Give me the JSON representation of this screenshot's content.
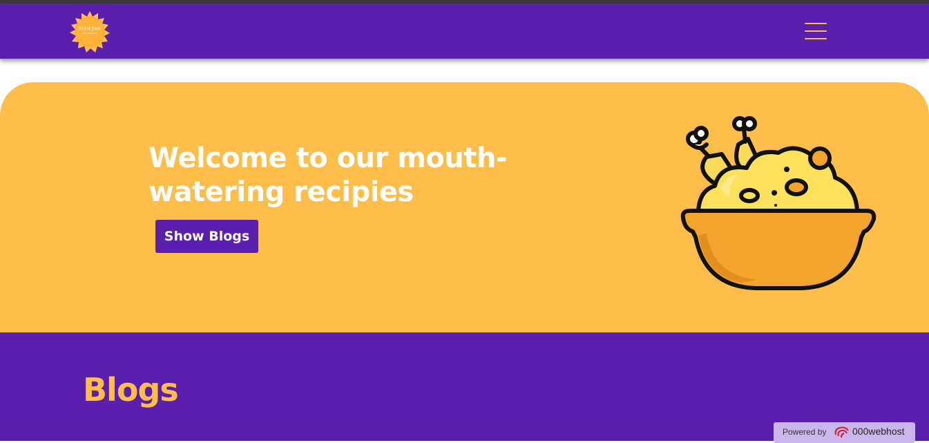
{
  "navbar": {
    "logo_title": "Royal Josh",
    "logo_subtitle": "Food Website",
    "menu_icon": "hamburger-menu-icon"
  },
  "hero": {
    "title": "Welcome to our mouth-watering recipies",
    "button_label": "Show Blogs",
    "illustration": "chicken-biryani-bowl-icon"
  },
  "blogs": {
    "title": "Blogs"
  },
  "badge": {
    "powered_label": "Powered by",
    "brand": "000webhost"
  },
  "colors": {
    "primary_purple": "#5b1fad",
    "accent_yellow": "#ffbd4a",
    "white": "#ffffff"
  }
}
